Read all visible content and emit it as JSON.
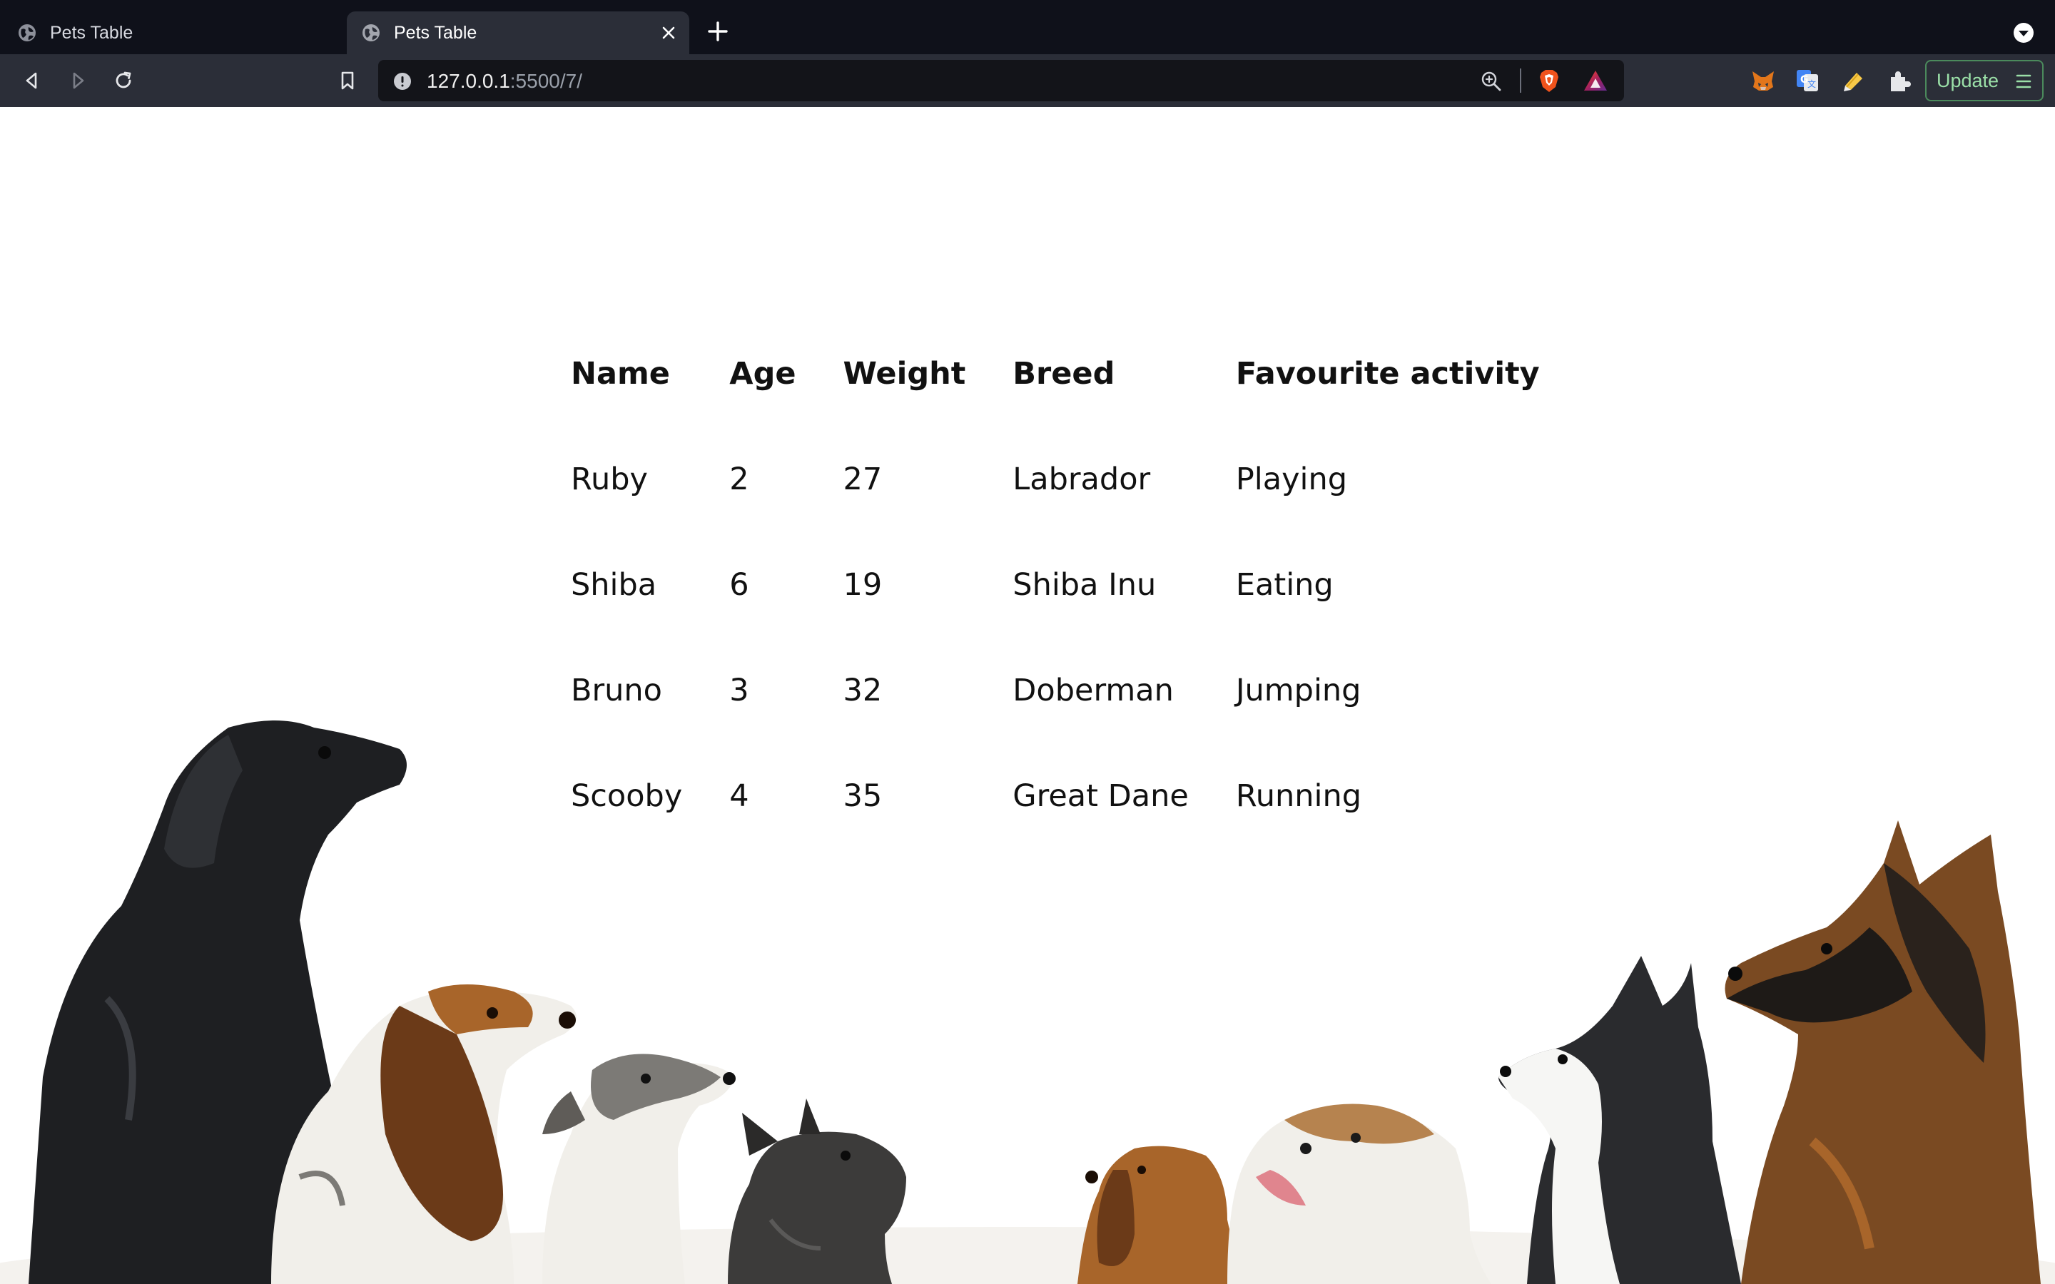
{
  "browser": {
    "tabs": [
      {
        "title": "Pets Table",
        "active": false
      },
      {
        "title": "Pets Table",
        "active": true
      }
    ],
    "url_host": "127.0.0.1",
    "url_rest": ":5500/7/",
    "update_label": "Update"
  },
  "pets_table": {
    "headers": [
      "Name",
      "Age",
      "Weight",
      "Breed",
      "Favourite activity"
    ],
    "rows": [
      [
        "Ruby",
        "2",
        "27",
        "Labrador",
        "Playing"
      ],
      [
        "Shiba",
        "6",
        "19",
        "Shiba Inu",
        "Eating"
      ],
      [
        "Bruno",
        "3",
        "32",
        "Doberman",
        "Jumping"
      ],
      [
        "Scooby",
        "4",
        "35",
        "Great Dane",
        "Running"
      ]
    ]
  },
  "background_image": {
    "subject": "dogs looking up",
    "colors": {
      "black_dog": "#1e1f22",
      "tan": "#a8652a",
      "white": "#f1efea",
      "grey": "#7c7a76"
    }
  }
}
